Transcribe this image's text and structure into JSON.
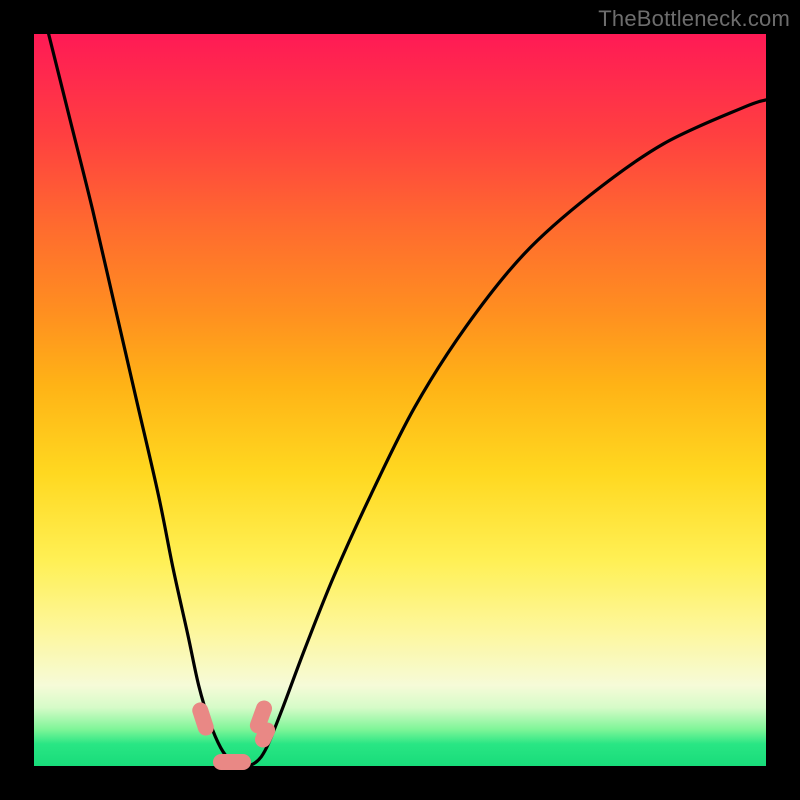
{
  "watermark": "TheBottleneck.com",
  "colors": {
    "frame": "#000000",
    "curve": "#010101",
    "marker": "#e98885",
    "gradient_top": "#ff1a55",
    "gradient_bottom": "#18dc7a"
  },
  "chart_data": {
    "type": "line",
    "title": "",
    "xlabel": "",
    "ylabel": "",
    "xlim": [
      0,
      100
    ],
    "ylim": [
      0,
      100
    ],
    "grid": false,
    "legend": false,
    "series": [
      {
        "name": "bottleneck-curve",
        "x": [
          2,
          5,
          8,
          11,
          14,
          17,
          19,
          21,
          22.5,
          24,
          25.5,
          27,
          28,
          29,
          30,
          31,
          32,
          34,
          37,
          41,
          46,
          52,
          59,
          67,
          76,
          86,
          97,
          100
        ],
        "y": [
          100,
          88,
          76,
          63,
          50,
          37,
          27,
          18,
          11,
          6,
          2.5,
          0.5,
          0,
          0,
          0.3,
          1.2,
          3,
          8,
          16,
          26,
          37,
          49,
          60,
          70,
          78,
          85,
          90,
          91
        ]
      }
    ],
    "markers": [
      {
        "shape": "capsule",
        "x": 23.1,
        "y": 6.5,
        "w_pct": 2.2,
        "h_pct": 4.6,
        "angle_deg": -18
      },
      {
        "shape": "capsule",
        "x": 31.0,
        "y": 6.7,
        "w_pct": 2.2,
        "h_pct": 4.6,
        "angle_deg": 20
      },
      {
        "shape": "capsule",
        "x": 31.5,
        "y": 4.2,
        "w_pct": 2.2,
        "h_pct": 3.6,
        "angle_deg": 25
      },
      {
        "shape": "capsule",
        "x": 27.0,
        "y": 0.6,
        "w_pct": 5.2,
        "h_pct": 2.2,
        "angle_deg": 0
      }
    ]
  }
}
